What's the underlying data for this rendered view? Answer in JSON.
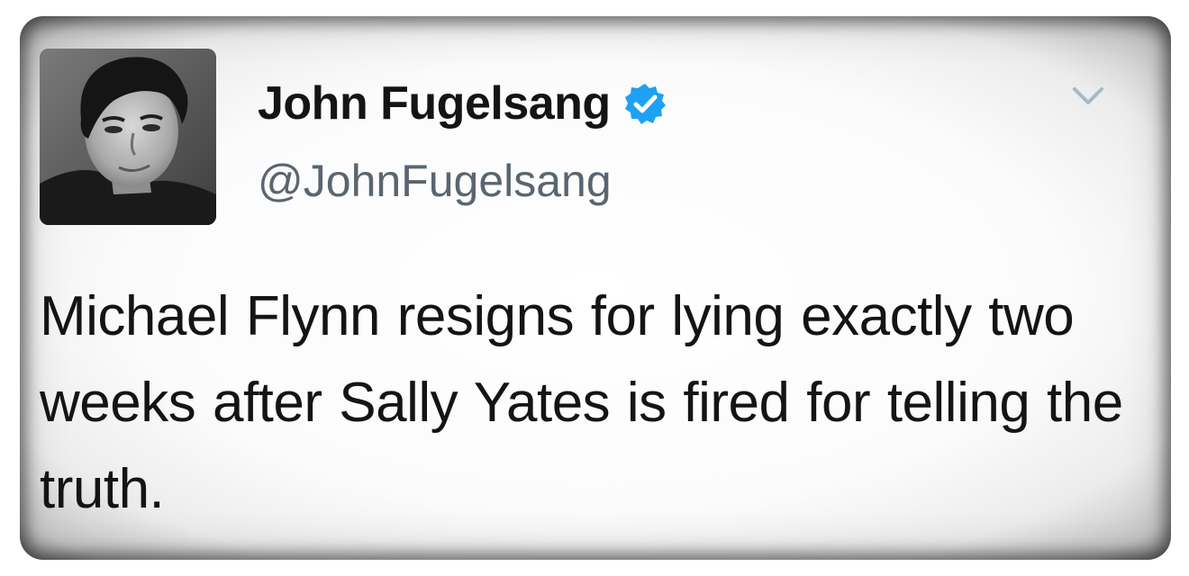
{
  "tweet": {
    "display_name": "John Fugelsang",
    "handle": "@JohnFugelsang",
    "verified": true,
    "text": "Michael Flynn resigns for lying exactly two weeks after Sally Yates is fired for telling the truth.",
    "icons": {
      "verified": "verified-badge-icon",
      "menu": "chevron-down-icon"
    }
  },
  "colors": {
    "verified_blue": "#1da1f2",
    "name_text": "#141414",
    "handle_text": "#5a6570",
    "body_text": "#141414",
    "caret": "#aab8c2"
  }
}
